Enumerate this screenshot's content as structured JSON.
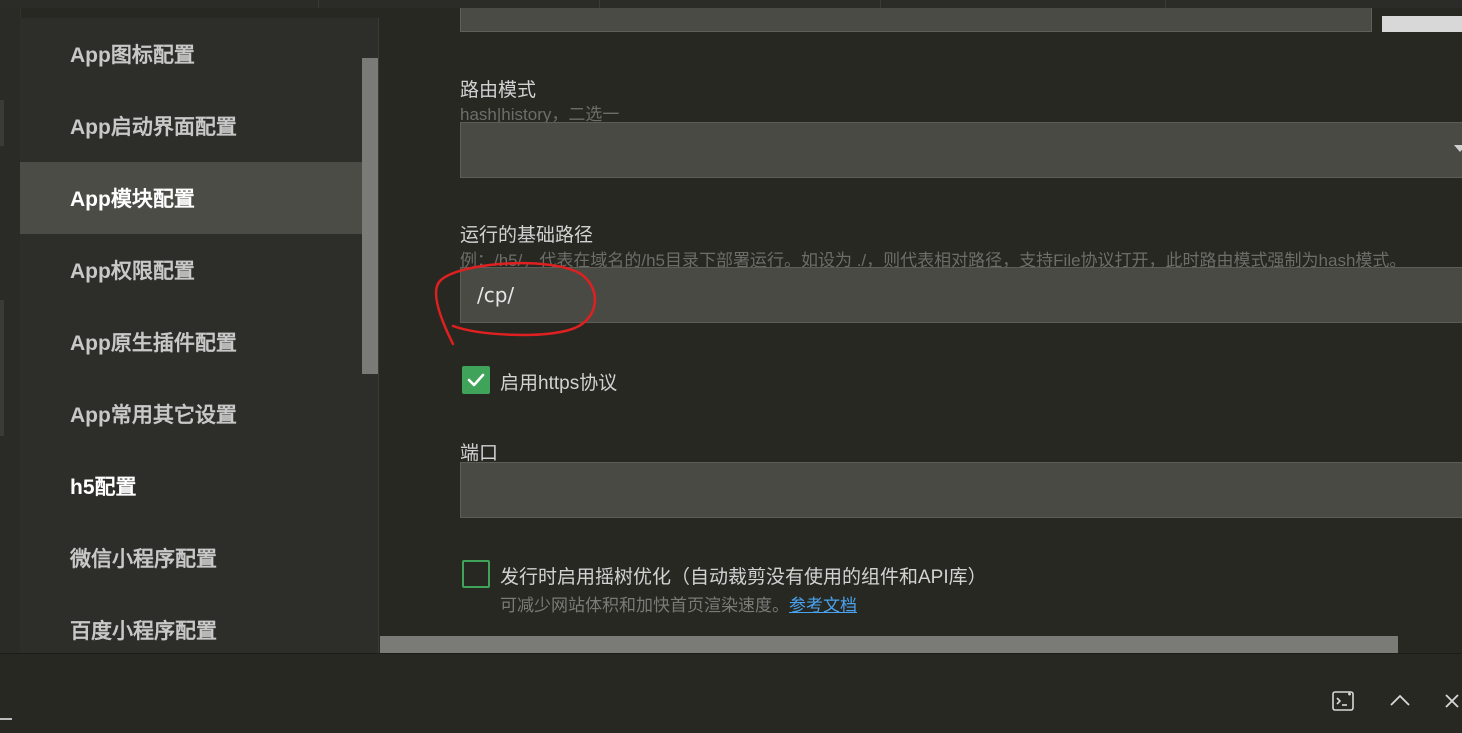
{
  "sidebar": {
    "items": [
      {
        "label": "App图标配置"
      },
      {
        "label": "App启动界面配置"
      },
      {
        "label": "App模块配置"
      },
      {
        "label": "App权限配置"
      },
      {
        "label": "App原生插件配置"
      },
      {
        "label": "App常用其它设置"
      },
      {
        "label": "h5配置"
      },
      {
        "label": "微信小程序配置"
      },
      {
        "label": "百度小程序配置"
      }
    ],
    "active_index": 2
  },
  "form": {
    "router_mode": {
      "label": "路由模式",
      "hint": "hash|history，二选一",
      "value": ""
    },
    "base_path": {
      "label": "运行的基础路径",
      "hint": "例：/h5/，代表在域名的/h5目录下部署运行。如设为 ./，则代表相对路径，支持File协议打开，此时路由模式强制为hash模式。",
      "value": "/cp/"
    },
    "https": {
      "label": "启用https协议",
      "checked": true
    },
    "port": {
      "label": "端口",
      "value": ""
    },
    "tree_shaking": {
      "label": "发行时启用摇树优化（自动裁剪没有使用的组件和API库）",
      "hint": "可减少网站体积和加快首页渲染速度。",
      "link": "参考文档",
      "checked": false
    }
  },
  "colors": {
    "background": "#272822",
    "sidebar_active": "#4b4c45",
    "checkbox": "#3fa45a",
    "link": "#4aa3f0",
    "annotation": "#e02020"
  },
  "bottombar": {
    "icons": [
      "terminal-icon",
      "chevron-up-icon",
      "close-icon"
    ]
  }
}
